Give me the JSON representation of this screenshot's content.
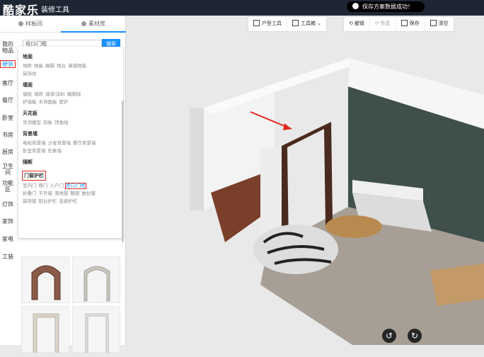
{
  "app": {
    "logo": "酷家乐",
    "subtitle": "装修工具"
  },
  "toast": {
    "message": "保存方案数据成功！"
  },
  "sidebar": {
    "tabs": [
      {
        "label": "样板间"
      },
      {
        "label": "素材库"
      }
    ],
    "categories": [
      {
        "label": "我的\n物品"
      },
      {
        "label": "硬装"
      },
      {
        "label": "客厅"
      },
      {
        "label": "餐厅"
      },
      {
        "label": "卧室"
      },
      {
        "label": "书房"
      },
      {
        "label": "厨房"
      },
      {
        "label": "卫生\n间"
      },
      {
        "label": "功能\n区"
      },
      {
        "label": "灯饰"
      },
      {
        "label": "家饰"
      },
      {
        "label": "家电"
      },
      {
        "label": "工装"
      }
    ],
    "search": {
      "value": "垭口/门框",
      "button": "搜索"
    },
    "dropdown": {
      "sections": [
        {
          "title": "地面",
          "items": [
            "地砖",
            "地板",
            "踢脚",
            "地台",
            "满铺地毯",
            "装饰纹"
          ]
        },
        {
          "title": "墙面",
          "items": [
            "墙纸",
            "墙砖",
            "墙漆/涂料",
            "踢脚线",
            "护墙板",
            "木饰面板",
            "壁炉"
          ]
        },
        {
          "title": "天花板",
          "items": [
            "吊顶模型",
            "扣板",
            "顶角线"
          ]
        },
        {
          "title": "背景墙",
          "items": [
            "电视背景墙",
            "沙发背景墙",
            "餐厅背景墙",
            "卧室背景墙",
            "形象墙"
          ]
        },
        {
          "title": "隔断",
          "items": []
        },
        {
          "title": "门窗护栏",
          "items": [
            "室内门",
            "移门",
            "入户门",
            "垭口/门框",
            "折叠门",
            "平开窗",
            "落地窗",
            "飘窗",
            "推拉窗",
            "装饰窗",
            "阳台护栏",
            "走廊护栏"
          ]
        }
      ]
    }
  },
  "toolbar": {
    "edit_room": "户型工具",
    "tools": "工具箱",
    "undo": "撤销",
    "redo": "恢复",
    "save": "保存",
    "clear": "清空"
  }
}
